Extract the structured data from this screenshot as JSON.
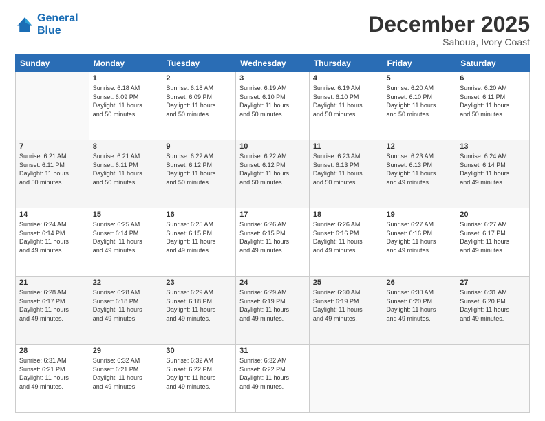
{
  "header": {
    "logo_line1": "General",
    "logo_line2": "Blue",
    "month": "December 2025",
    "location": "Sahoua, Ivory Coast"
  },
  "weekdays": [
    "Sunday",
    "Monday",
    "Tuesday",
    "Wednesday",
    "Thursday",
    "Friday",
    "Saturday"
  ],
  "weeks": [
    [
      {
        "day": "",
        "info": ""
      },
      {
        "day": "1",
        "info": "Sunrise: 6:18 AM\nSunset: 6:09 PM\nDaylight: 11 hours\nand 50 minutes."
      },
      {
        "day": "2",
        "info": "Sunrise: 6:18 AM\nSunset: 6:09 PM\nDaylight: 11 hours\nand 50 minutes."
      },
      {
        "day": "3",
        "info": "Sunrise: 6:19 AM\nSunset: 6:10 PM\nDaylight: 11 hours\nand 50 minutes."
      },
      {
        "day": "4",
        "info": "Sunrise: 6:19 AM\nSunset: 6:10 PM\nDaylight: 11 hours\nand 50 minutes."
      },
      {
        "day": "5",
        "info": "Sunrise: 6:20 AM\nSunset: 6:10 PM\nDaylight: 11 hours\nand 50 minutes."
      },
      {
        "day": "6",
        "info": "Sunrise: 6:20 AM\nSunset: 6:11 PM\nDaylight: 11 hours\nand 50 minutes."
      }
    ],
    [
      {
        "day": "7",
        "info": "Sunrise: 6:21 AM\nSunset: 6:11 PM\nDaylight: 11 hours\nand 50 minutes."
      },
      {
        "day": "8",
        "info": "Sunrise: 6:21 AM\nSunset: 6:11 PM\nDaylight: 11 hours\nand 50 minutes."
      },
      {
        "day": "9",
        "info": "Sunrise: 6:22 AM\nSunset: 6:12 PM\nDaylight: 11 hours\nand 50 minutes."
      },
      {
        "day": "10",
        "info": "Sunrise: 6:22 AM\nSunset: 6:12 PM\nDaylight: 11 hours\nand 50 minutes."
      },
      {
        "day": "11",
        "info": "Sunrise: 6:23 AM\nSunset: 6:13 PM\nDaylight: 11 hours\nand 50 minutes."
      },
      {
        "day": "12",
        "info": "Sunrise: 6:23 AM\nSunset: 6:13 PM\nDaylight: 11 hours\nand 49 minutes."
      },
      {
        "day": "13",
        "info": "Sunrise: 6:24 AM\nSunset: 6:14 PM\nDaylight: 11 hours\nand 49 minutes."
      }
    ],
    [
      {
        "day": "14",
        "info": "Sunrise: 6:24 AM\nSunset: 6:14 PM\nDaylight: 11 hours\nand 49 minutes."
      },
      {
        "day": "15",
        "info": "Sunrise: 6:25 AM\nSunset: 6:14 PM\nDaylight: 11 hours\nand 49 minutes."
      },
      {
        "day": "16",
        "info": "Sunrise: 6:25 AM\nSunset: 6:15 PM\nDaylight: 11 hours\nand 49 minutes."
      },
      {
        "day": "17",
        "info": "Sunrise: 6:26 AM\nSunset: 6:15 PM\nDaylight: 11 hours\nand 49 minutes."
      },
      {
        "day": "18",
        "info": "Sunrise: 6:26 AM\nSunset: 6:16 PM\nDaylight: 11 hours\nand 49 minutes."
      },
      {
        "day": "19",
        "info": "Sunrise: 6:27 AM\nSunset: 6:16 PM\nDaylight: 11 hours\nand 49 minutes."
      },
      {
        "day": "20",
        "info": "Sunrise: 6:27 AM\nSunset: 6:17 PM\nDaylight: 11 hours\nand 49 minutes."
      }
    ],
    [
      {
        "day": "21",
        "info": "Sunrise: 6:28 AM\nSunset: 6:17 PM\nDaylight: 11 hours\nand 49 minutes."
      },
      {
        "day": "22",
        "info": "Sunrise: 6:28 AM\nSunset: 6:18 PM\nDaylight: 11 hours\nand 49 minutes."
      },
      {
        "day": "23",
        "info": "Sunrise: 6:29 AM\nSunset: 6:18 PM\nDaylight: 11 hours\nand 49 minutes."
      },
      {
        "day": "24",
        "info": "Sunrise: 6:29 AM\nSunset: 6:19 PM\nDaylight: 11 hours\nand 49 minutes."
      },
      {
        "day": "25",
        "info": "Sunrise: 6:30 AM\nSunset: 6:19 PM\nDaylight: 11 hours\nand 49 minutes."
      },
      {
        "day": "26",
        "info": "Sunrise: 6:30 AM\nSunset: 6:20 PM\nDaylight: 11 hours\nand 49 minutes."
      },
      {
        "day": "27",
        "info": "Sunrise: 6:31 AM\nSunset: 6:20 PM\nDaylight: 11 hours\nand 49 minutes."
      }
    ],
    [
      {
        "day": "28",
        "info": "Sunrise: 6:31 AM\nSunset: 6:21 PM\nDaylight: 11 hours\nand 49 minutes."
      },
      {
        "day": "29",
        "info": "Sunrise: 6:32 AM\nSunset: 6:21 PM\nDaylight: 11 hours\nand 49 minutes."
      },
      {
        "day": "30",
        "info": "Sunrise: 6:32 AM\nSunset: 6:22 PM\nDaylight: 11 hours\nand 49 minutes."
      },
      {
        "day": "31",
        "info": "Sunrise: 6:32 AM\nSunset: 6:22 PM\nDaylight: 11 hours\nand 49 minutes."
      },
      {
        "day": "",
        "info": ""
      },
      {
        "day": "",
        "info": ""
      },
      {
        "day": "",
        "info": ""
      }
    ]
  ]
}
